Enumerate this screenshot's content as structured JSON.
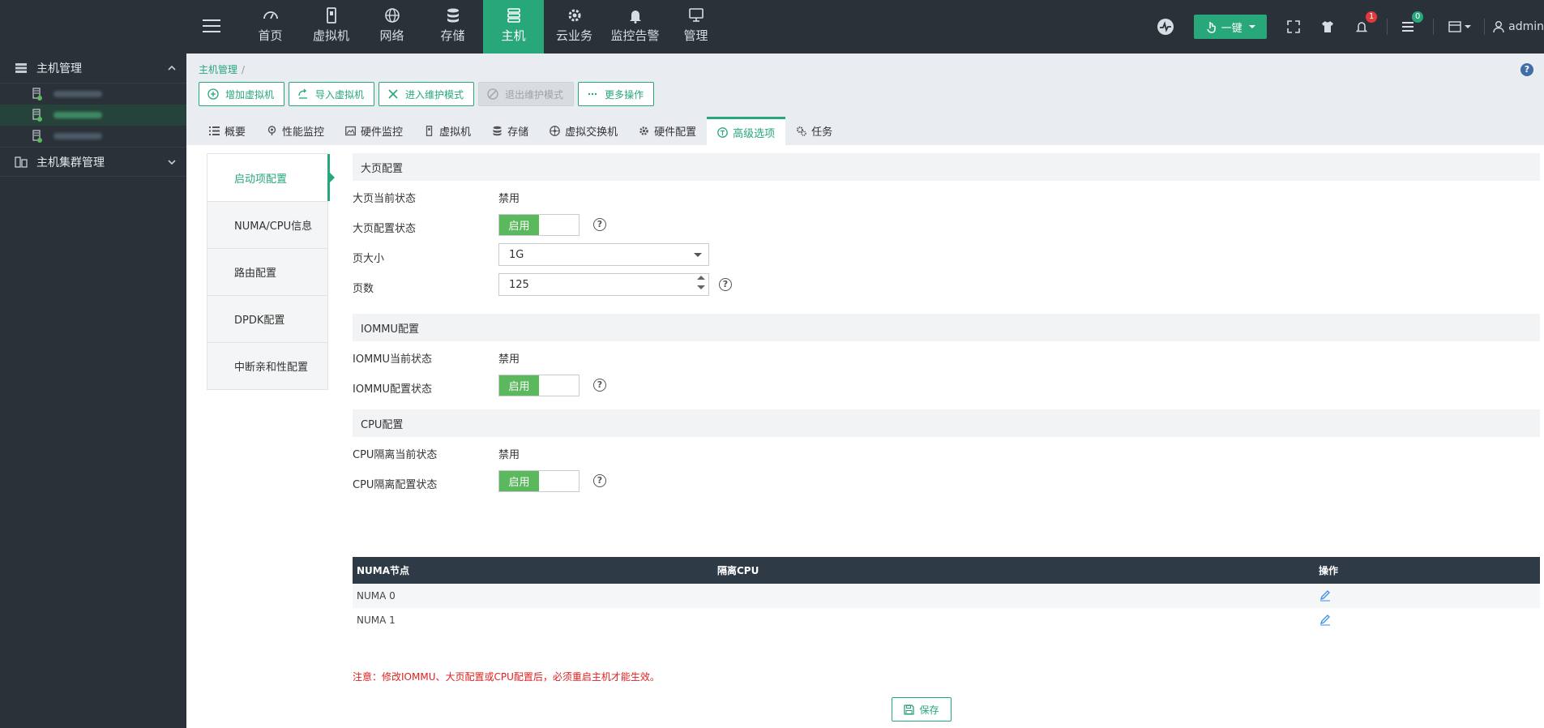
{
  "nav": {
    "items": [
      {
        "label": "首页",
        "icon": "dashboard-icon"
      },
      {
        "label": "虚拟机",
        "icon": "vm-icon"
      },
      {
        "label": "网络",
        "icon": "globe-icon"
      },
      {
        "label": "存储",
        "icon": "database-icon"
      },
      {
        "label": "主机",
        "icon": "server-icon"
      },
      {
        "label": "云业务",
        "icon": "gear-icon"
      },
      {
        "label": "监控告警",
        "icon": "bell-icon"
      },
      {
        "label": "管理",
        "icon": "monitor-icon"
      }
    ],
    "active": "主机"
  },
  "toolbar": {
    "onekey_label": "一键",
    "alarm_count": "1",
    "task_count": "0",
    "user": "admin"
  },
  "sidebar": {
    "group1": "主机管理",
    "group2": "主机集群管理"
  },
  "breadcrumb": {
    "root": "主机管理",
    "sep": "/"
  },
  "actions": {
    "add_vm": "增加虚拟机",
    "import_vm": "导入虚拟机",
    "enter_maint": "进入维护模式",
    "exit_maint": "退出维护模式",
    "more": "更多操作"
  },
  "tabs": [
    {
      "label": "概要"
    },
    {
      "label": "性能监控"
    },
    {
      "label": "硬件监控"
    },
    {
      "label": "虚拟机"
    },
    {
      "label": "存储"
    },
    {
      "label": "虚拟交换机"
    },
    {
      "label": "硬件配置"
    },
    {
      "label": "高级选项"
    },
    {
      "label": "任务"
    }
  ],
  "vmenu": [
    {
      "label": "启动项配置"
    },
    {
      "label": "NUMA/CPU信息"
    },
    {
      "label": "路由配置"
    },
    {
      "label": "DPDK配置"
    },
    {
      "label": "中断亲和性配置"
    }
  ],
  "hugepage": {
    "title": "大页配置",
    "current_label": "大页当前状态",
    "current_value": "禁用",
    "config_label": "大页配置状态",
    "toggle": "启用",
    "size_label": "页大小",
    "size_value": "1G",
    "count_label": "页数",
    "count_value": "125"
  },
  "iommu": {
    "title": "IOMMU配置",
    "current_label": "IOMMU当前状态",
    "current_value": "禁用",
    "config_label": "IOMMU配置状态",
    "toggle": "启用"
  },
  "cpu": {
    "title": "CPU配置",
    "current_label": "CPU隔离当前状态",
    "current_value": "禁用",
    "config_label": "CPU隔离配置状态",
    "toggle": "启用"
  },
  "table": {
    "headers": [
      "NUMA节点",
      "隔离CPU",
      "操作"
    ],
    "rows": [
      {
        "node": "NUMA 0",
        "cpu": ""
      },
      {
        "node": "NUMA 1",
        "cpu": ""
      }
    ]
  },
  "note": "注意：修改IOMMU、大页配置或CPU配置后，必须重启主机才能生效。",
  "save_label": "保存",
  "colors": {
    "accent": "#27a77a",
    "navbar": "#2a3139",
    "toggle_on": "#5cb85c",
    "alarm_badge": "#e03a3a",
    "task_badge": "#27a77a",
    "warning_text": "#e02020"
  }
}
